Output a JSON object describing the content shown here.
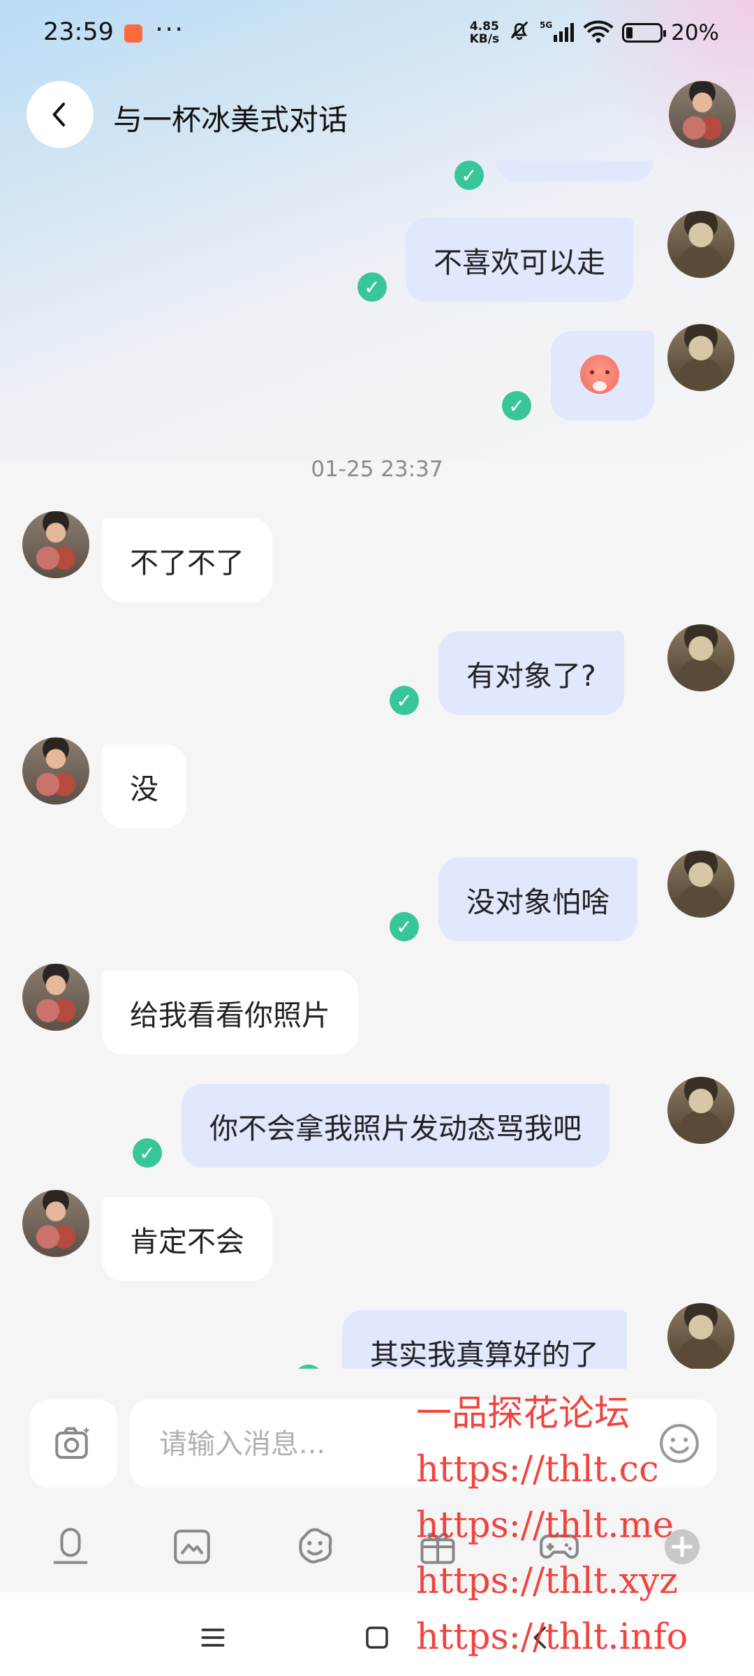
{
  "status_bar": {
    "time": "23:59",
    "more": "···",
    "net_speed_top": "4.85",
    "net_speed_bottom": "KB/s",
    "battery": "20%"
  },
  "header": {
    "title": "与一杯冰美式对话"
  },
  "messages": [
    {
      "dir": "out",
      "text": "不喜欢可以走"
    },
    {
      "dir": "out",
      "type": "sticker",
      "icon": "pleading-face-sticker"
    },
    {
      "dir": "in",
      "text": "不了不了"
    },
    {
      "dir": "out",
      "text": "有对象了?"
    },
    {
      "dir": "in",
      "text": "没"
    },
    {
      "dir": "out",
      "text": "没对象怕啥"
    },
    {
      "dir": "in",
      "text": "给我看看你照片"
    },
    {
      "dir": "out",
      "text": "你不会拿我照片发动态骂我吧"
    },
    {
      "dir": "in",
      "text": "肯定不会"
    },
    {
      "dir": "out",
      "text": "其实我真算好的了"
    }
  ],
  "timestamp": "01-25 23:37",
  "input": {
    "placeholder": "请输入消息..."
  },
  "toolbar": {
    "icons": [
      "voice-icon",
      "image-icon",
      "sticker-icon",
      "gift-icon",
      "game-icon",
      "plus-icon"
    ]
  },
  "watermark": {
    "lines": [
      "一品探花论坛",
      "https://thlt.cc",
      "https://thlt.me",
      "https://thlt.xyz",
      "https://thlt.info"
    ]
  },
  "colors": {
    "outgoing_bubble": "#e1e7fd",
    "incoming_bubble": "#ffffff",
    "read_check": "#39c59a",
    "watermark": "#f0302a"
  }
}
